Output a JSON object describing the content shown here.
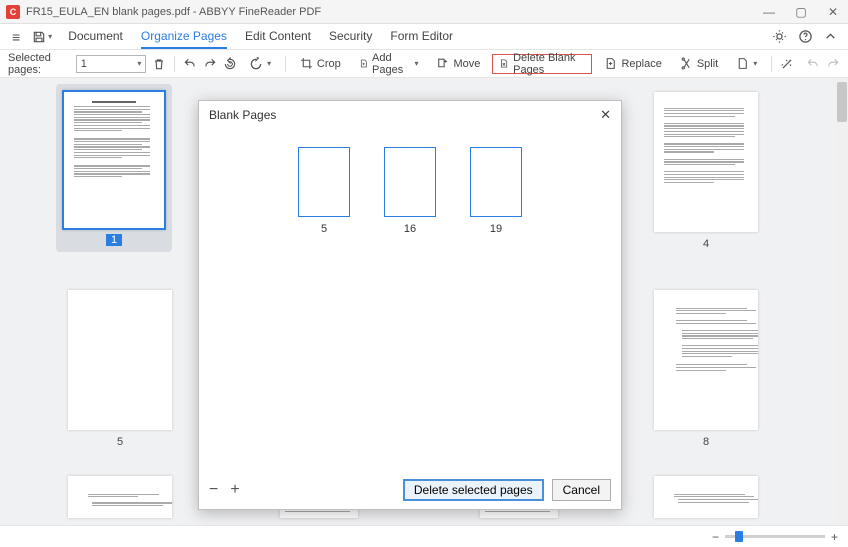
{
  "window": {
    "title": "FR15_EULA_EN blank pages.pdf - ABBYY FineReader PDF"
  },
  "tabs": {
    "document": "Document",
    "organize": "Organize Pages",
    "edit": "Edit Content",
    "security": "Security",
    "form": "Form Editor"
  },
  "toolbar": {
    "selected_label": "Selected pages:",
    "selected_value": "1",
    "crop": "Crop",
    "add_pages": "Add Pages",
    "move": "Move",
    "delete_blank": "Delete Blank Pages",
    "replace": "Replace",
    "split": "Split"
  },
  "thumbs": {
    "p1": "1",
    "p4": "4",
    "p5": "5",
    "p8": "8"
  },
  "dialog": {
    "title": "Blank Pages",
    "pages": {
      "a": "5",
      "b": "16",
      "c": "19"
    },
    "delete_btn": "Delete selected pages",
    "cancel_btn": "Cancel"
  }
}
